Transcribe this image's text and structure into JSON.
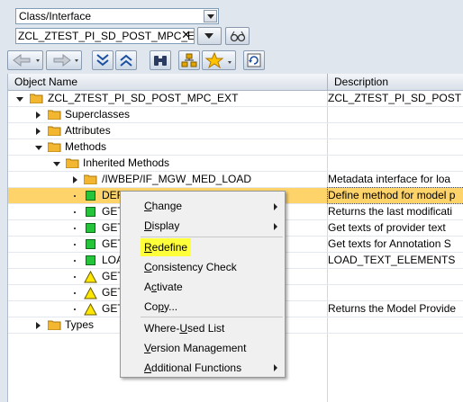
{
  "selector": {
    "value": "Class/Interface"
  },
  "object_input": {
    "value": "ZCL_ZTEST_PI_SD_POST_MPC_E",
    "clear_symbol": "✕"
  },
  "grid": {
    "headers": {
      "name": "Object Name",
      "description": "Description"
    },
    "rows": [
      {
        "name": "ZCL_ZTEST_PI_SD_POST_MPC_EXT",
        "desc": "ZCL_ZTEST_PI_SD_POST"
      },
      {
        "name": "Superclasses",
        "desc": ""
      },
      {
        "name": "Attributes",
        "desc": ""
      },
      {
        "name": "Methods",
        "desc": ""
      },
      {
        "name": "Inherited Methods",
        "desc": ""
      },
      {
        "name": "/IWBEP/IF_MGW_MED_LOAD",
        "desc": "Metadata interface for loa"
      },
      {
        "name": "DEF",
        "desc": "Define method for model p"
      },
      {
        "name": "GET",
        "desc": "Returns the last modificati"
      },
      {
        "name": "GET",
        "desc": "Get texts of provider text"
      },
      {
        "name": "GET",
        "desc": "Get texts for Annotation S"
      },
      {
        "name": "LOA",
        "desc": "LOAD_TEXT_ELEMENTS"
      },
      {
        "name": "GET",
        "desc": ""
      },
      {
        "name": "GET",
        "desc": ""
      },
      {
        "name": "GET",
        "desc": "Returns the Model Provide"
      },
      {
        "name": "Types",
        "desc": ""
      }
    ]
  },
  "context_menu": {
    "items": [
      {
        "pre": "",
        "u": "C",
        "post": "hange"
      },
      {
        "pre": "",
        "u": "D",
        "post": "isplay"
      },
      {
        "pre": "",
        "u": "R",
        "post": "edefine"
      },
      {
        "pre": "",
        "u": "C",
        "post": "onsistency Check"
      },
      {
        "pre": "A",
        "u": "c",
        "post": "tivate"
      },
      {
        "pre": "Co",
        "u": "p",
        "post": "y..."
      },
      {
        "pre": "Where-",
        "u": "U",
        "post": "sed List"
      },
      {
        "pre": "",
        "u": "V",
        "post": "ersion Management"
      },
      {
        "pre": "",
        "u": "A",
        "post": "dditional Functions"
      }
    ]
  },
  "colors": {
    "selected_row": "#fdd36a",
    "highlight": "#ffff3a",
    "status_ok": "#25c43b",
    "status_warn": "#ffe800"
  }
}
